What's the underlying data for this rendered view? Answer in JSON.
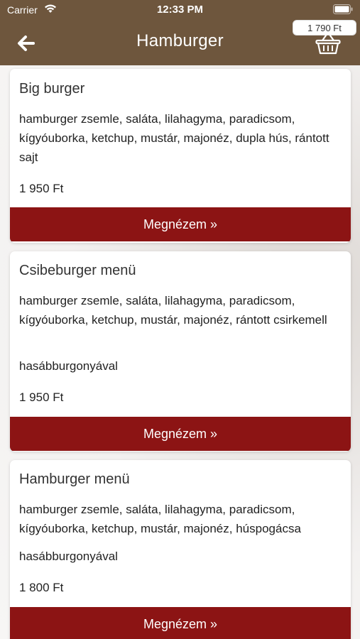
{
  "status_bar": {
    "carrier": "Carrier",
    "time": "12:33 PM"
  },
  "header": {
    "title": "Hamburger",
    "cart_total": "1 790 Ft"
  },
  "products": [
    {
      "name": "Big burger",
      "description": "hamburger zsemle, saláta, lilahagyma, paradicsom, kígyóuborka, ketchup, mustár, majonéz, dupla hús, rántott sajt",
      "extra": "",
      "price": "1 950 Ft",
      "button_label": "Megnézem »"
    },
    {
      "name": "Csibeburger menü",
      "description": "hamburger zsemle, saláta, lilahagyma, paradicsom, kígyóuborka, ketchup, mustár, majonéz, rántott csirkemell",
      "extra": "hasábburgonyával",
      "price": "1 950 Ft",
      "button_label": "Megnézem »"
    },
    {
      "name": "Hamburger menü",
      "description": "hamburger zsemle, saláta, lilahagyma, paradicsom, kígyóuborka, ketchup, mustár, majonéz, húspogácsa",
      "extra": "hasábburgonyával",
      "price": "1 800 Ft",
      "button_label": "Megnézem »"
    }
  ],
  "colors": {
    "header_bg": "#6e563d",
    "button_bg": "#8c1414"
  }
}
